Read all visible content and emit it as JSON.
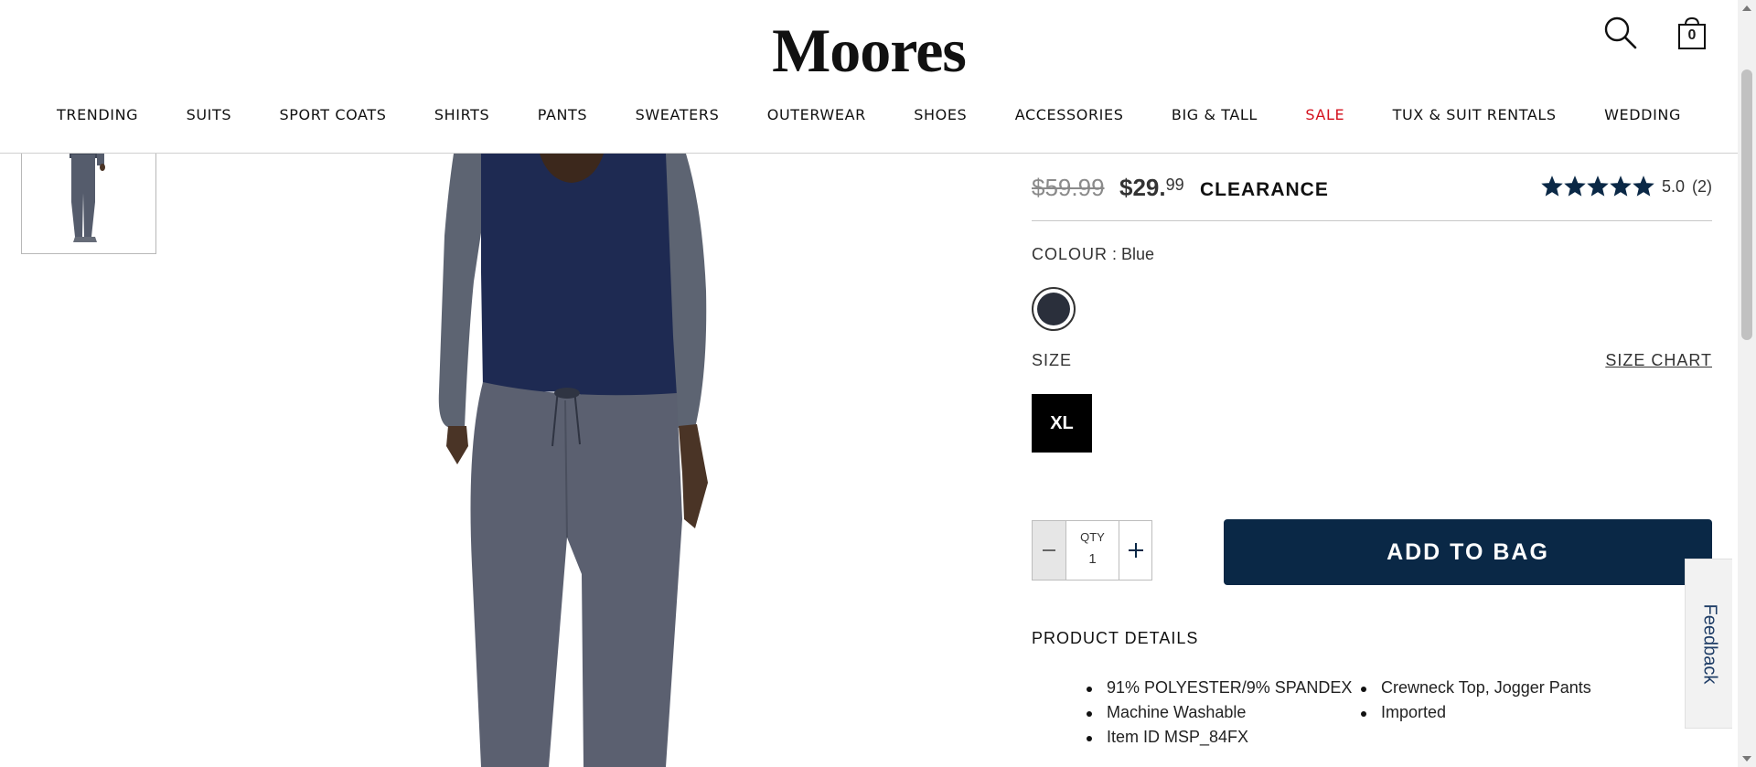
{
  "header": {
    "logo": "Moores",
    "search_icon": "search-icon",
    "bag_icon": "shopping-bag-icon",
    "bag_count": "0"
  },
  "nav": {
    "items": [
      {
        "label": "TRENDING"
      },
      {
        "label": "SUITS"
      },
      {
        "label": "SPORT COATS"
      },
      {
        "label": "SHIRTS"
      },
      {
        "label": "PANTS"
      },
      {
        "label": "SWEATERS"
      },
      {
        "label": "OUTERWEAR"
      },
      {
        "label": "SHOES"
      },
      {
        "label": "ACCESSORIES"
      },
      {
        "label": "BIG & TALL"
      },
      {
        "label": "SALE"
      },
      {
        "label": "TUX & SUIT RENTALS"
      },
      {
        "label": "WEDDING"
      }
    ],
    "sale_color": "#d4121e"
  },
  "product": {
    "old_price": "$59.99",
    "new_price_main": "$29.",
    "new_price_cents": "99",
    "clearance": "CLEARANCE",
    "rating_value": "5.0",
    "rating_count": "(2)",
    "stars_filled": 5,
    "colour_label": "COLOUR",
    "colour_sep": " : ",
    "colour_value": "Blue",
    "swatch_color": "#2a2f3b",
    "size_label": "SIZE",
    "size_chart": "SIZE CHART",
    "selected_size": "XL",
    "qty_label": "QTY",
    "qty_value": "1",
    "add_to_bag": "ADD TO BAG",
    "accent_color": "#0a2846",
    "details_header": "PRODUCT DETAILS",
    "details_toggle": "-",
    "details_col_a": [
      "91% POLYESTER/9% SPANDEX",
      "Machine Washable",
      "Item ID MSP_84FX"
    ],
    "details_col_b": [
      "Crewneck Top, Jogger Pants",
      "Imported"
    ]
  },
  "feedback": {
    "label": "Feedback"
  }
}
